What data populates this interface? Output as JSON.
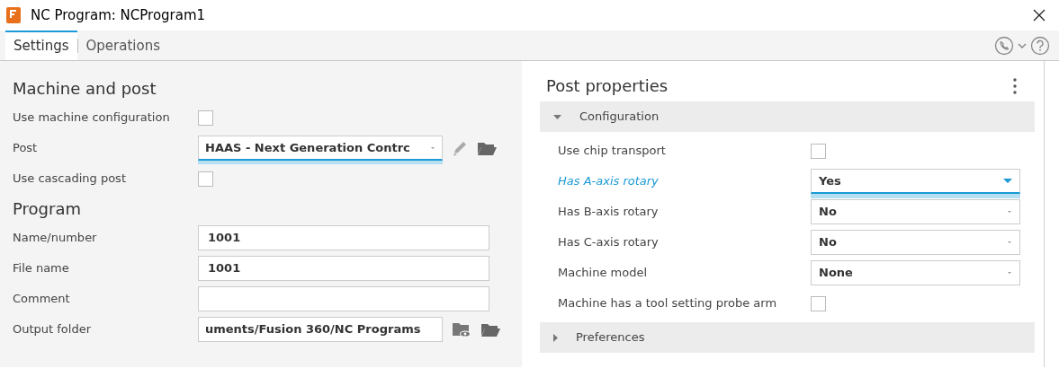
{
  "window": {
    "title": "NC Program: NCProgram1"
  },
  "tabs": [
    {
      "label": "Settings",
      "selected": true
    },
    {
      "label": "Operations",
      "selected": false
    }
  ],
  "settings": {
    "sections": [
      {
        "heading": "Machine and post",
        "rows": [
          {
            "kind": "checkbox",
            "label": "Use machine configuration",
            "checked": false
          },
          {
            "kind": "select",
            "label": "Post",
            "value": "HAAS - Next Generation Contrc",
            "focused": true
          },
          {
            "kind": "checkbox",
            "label": "Use cascading post",
            "checked": false
          }
        ]
      },
      {
        "heading": "Program",
        "rows": [
          {
            "kind": "text",
            "label": "Name/number",
            "value": "1001"
          },
          {
            "kind": "text",
            "label": "File name",
            "value": "1001"
          },
          {
            "kind": "text",
            "label": "Comment"
          },
          {
            "kind": "folder",
            "label": "Output folder",
            "value": "uments/Fusion 360/NC Programs"
          }
        ]
      }
    ]
  },
  "post_properties": {
    "heading": "Post properties",
    "groups": [
      {
        "label": "Configuration",
        "expanded": true,
        "rows": [
          {
            "kind": "checkbox",
            "label": "Use chip transport",
            "checked": false,
            "focused": false
          },
          {
            "kind": "select",
            "label": "Has A-axis rotary",
            "value": "Yes",
            "focused": true
          },
          {
            "kind": "select",
            "label": "Has B-axis rotary",
            "value": "No",
            "focused": false
          },
          {
            "kind": "select",
            "label": "Has C-axis rotary",
            "value": "No",
            "focused": false
          },
          {
            "kind": "select",
            "label": "Machine model",
            "value": "None",
            "focused": false
          },
          {
            "kind": "checkbox",
            "label": "Machine has a tool setting probe arm",
            "checked": false,
            "focused": false
          }
        ]
      },
      {
        "label": "Preferences",
        "expanded": false
      }
    ]
  }
}
